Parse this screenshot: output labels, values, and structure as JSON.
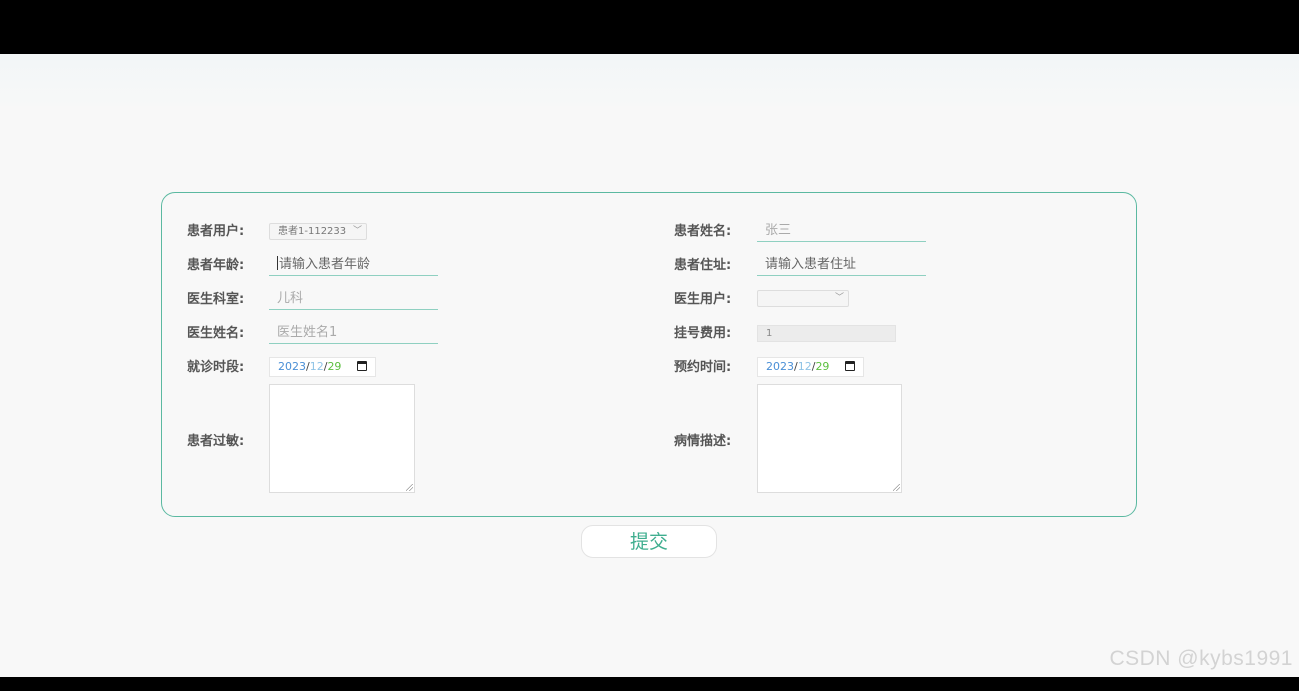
{
  "form": {
    "patient_user_label": "患者用户:",
    "patient_user_value": "患者1-112233",
    "patient_name_label": "患者姓名:",
    "patient_name_value": "张三",
    "patient_age_label": "患者年龄:",
    "patient_age_placeholder": "请输入患者年龄",
    "patient_address_label": "患者住址:",
    "patient_address_placeholder": "请输入患者住址",
    "doctor_dept_label": "医生科室:",
    "doctor_dept_value": "儿科",
    "doctor_user_label": "医生用户:",
    "doctor_user_value": "",
    "doctor_name_label": "医生姓名:",
    "doctor_name_value": "医生姓名1",
    "fee_label": "挂号费用:",
    "fee_value": "1",
    "visit_period_label": "就诊时段:",
    "visit_period_date": {
      "year": "2023",
      "month": "12",
      "day": "29"
    },
    "appointment_time_label": "预约时间:",
    "appointment_time_date": {
      "year": "2023",
      "month": "12",
      "day": "29"
    },
    "allergy_label": "患者过敏:",
    "condition_label": "病情描述:"
  },
  "actions": {
    "submit_label": "提交"
  },
  "watermark": "CSDN @kybs1991",
  "colors": {
    "accent": "#3fae8f",
    "border": "#5bb9a1",
    "underline": "#8fd0c1"
  }
}
